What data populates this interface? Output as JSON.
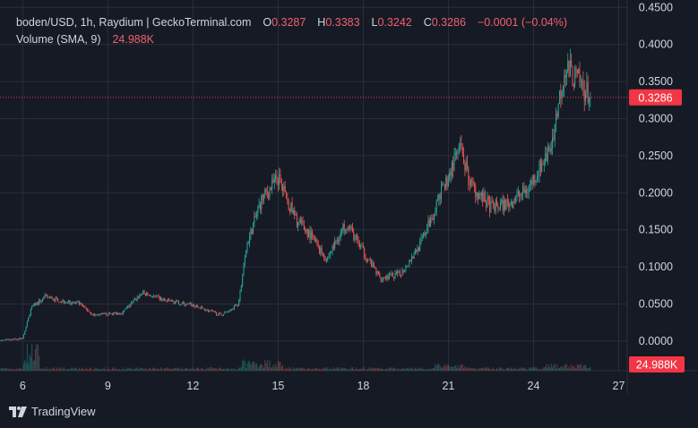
{
  "legend": {
    "symbol": "boden/USD, 1h, Raydium | GeckoTerminal.com",
    "o_label": "O",
    "o": "0.3287",
    "h_label": "H",
    "h": "0.3383",
    "l_label": "L",
    "l": "0.3242",
    "c_label": "C",
    "c": "0.3286",
    "change": "−0.0001 (−0.04%)",
    "volume_label": "Volume (SMA, 9)",
    "volume": "24.988K"
  },
  "branding": {
    "text": "TradingView",
    "icon": "tradingview-logo-icon"
  },
  "colors": {
    "background": "#161a25",
    "grid": "#2a2e39",
    "up": "#26a69a",
    "down": "#ef5350",
    "text": "#d1d4dc",
    "price_line": "#f23645"
  },
  "chart_data": {
    "type": "candlestick",
    "title": "boden/USD, 1h, Raydium | GeckoTerminal.com",
    "x_axis": {
      "ticks": [
        "6",
        "9",
        "12",
        "15",
        "18",
        "21",
        "24",
        "27"
      ],
      "tick_positions": [
        6,
        9,
        12,
        15,
        18,
        21,
        24,
        27
      ],
      "xlim": [
        5.2,
        27.3
      ]
    },
    "y_axis": {
      "ticks": [
        "0.0000",
        "0.0500",
        "0.1000",
        "0.1500",
        "0.2000",
        "0.2500",
        "0.3000",
        "0.3500",
        "0.4000",
        "0.4500"
      ],
      "ylim": [
        -0.04,
        0.46
      ],
      "position": "right"
    },
    "last_price": 0.3286,
    "last_price_label": "0.3286",
    "volume_label_value": "24.988K",
    "grid": true,
    "series_trend": [
      {
        "day": 5.2,
        "price": 0.0
      },
      {
        "day": 6.0,
        "price": 0.003
      },
      {
        "day": 6.3,
        "price": 0.045
      },
      {
        "day": 6.8,
        "price": 0.06
      },
      {
        "day": 7.3,
        "price": 0.055
      },
      {
        "day": 8.0,
        "price": 0.05
      },
      {
        "day": 8.5,
        "price": 0.035
      },
      {
        "day": 9.5,
        "price": 0.038
      },
      {
        "day": 10.2,
        "price": 0.065
      },
      {
        "day": 11.0,
        "price": 0.055
      },
      {
        "day": 12.0,
        "price": 0.048
      },
      {
        "day": 13.0,
        "price": 0.035
      },
      {
        "day": 13.6,
        "price": 0.05
      },
      {
        "day": 13.9,
        "price": 0.13
      },
      {
        "day": 14.4,
        "price": 0.19
      },
      {
        "day": 15.0,
        "price": 0.22
      },
      {
        "day": 15.6,
        "price": 0.165
      },
      {
        "day": 16.2,
        "price": 0.14
      },
      {
        "day": 16.7,
        "price": 0.11
      },
      {
        "day": 17.4,
        "price": 0.16
      },
      {
        "day": 18.0,
        "price": 0.12
      },
      {
        "day": 18.6,
        "price": 0.085
      },
      {
        "day": 19.3,
        "price": 0.09
      },
      {
        "day": 20.0,
        "price": 0.13
      },
      {
        "day": 20.6,
        "price": 0.185
      },
      {
        "day": 21.4,
        "price": 0.26
      },
      {
        "day": 21.8,
        "price": 0.21
      },
      {
        "day": 22.5,
        "price": 0.18
      },
      {
        "day": 23.1,
        "price": 0.185
      },
      {
        "day": 23.8,
        "price": 0.205
      },
      {
        "day": 24.6,
        "price": 0.26
      },
      {
        "day": 25.1,
        "price": 0.37
      },
      {
        "day": 25.6,
        "price": 0.35
      },
      {
        "day": 26.0,
        "price": 0.3286
      }
    ]
  }
}
